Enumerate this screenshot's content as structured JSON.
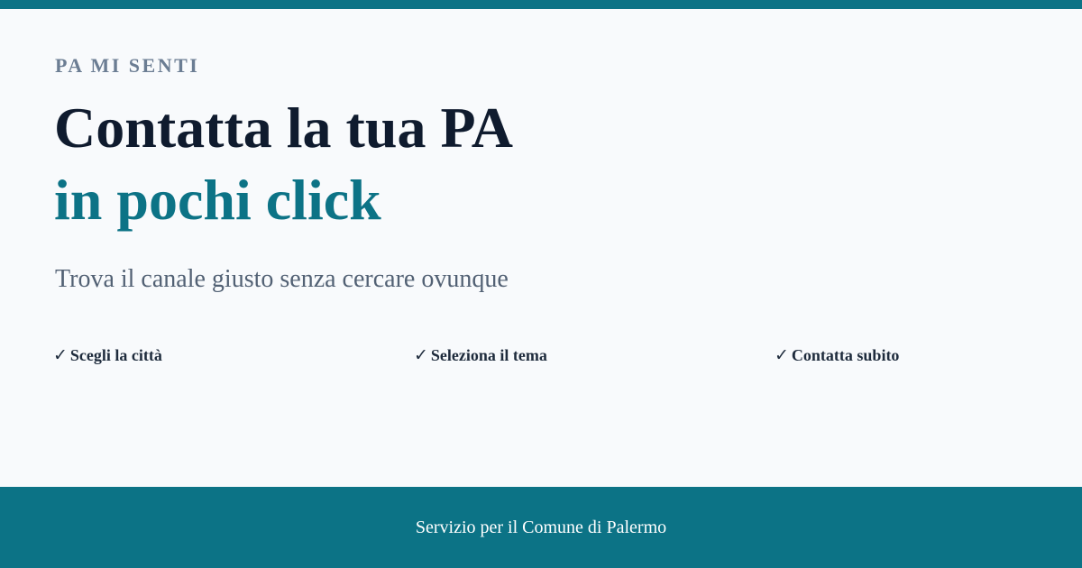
{
  "brand": {
    "eyebrow": "PA MI SENTI"
  },
  "hero": {
    "headline_line1": "Contatta la tua PA",
    "headline_line2": "in pochi click",
    "subtitle": "Trova il canale giusto senza cercare ovunque"
  },
  "features": [
    {
      "icon": "check-icon",
      "label": "Scegli la città"
    },
    {
      "icon": "check-icon",
      "label": "Seleziona il tema"
    },
    {
      "icon": "check-icon",
      "label": "Contatta subito"
    }
  ],
  "footer": {
    "text": "Servizio per il Comune di Palermo"
  },
  "colors": {
    "accent": "#0c7386",
    "headline": "#0f1b2e",
    "eyebrow": "#6b7d93",
    "subtitle": "#526174",
    "background": "#f8fafc"
  }
}
